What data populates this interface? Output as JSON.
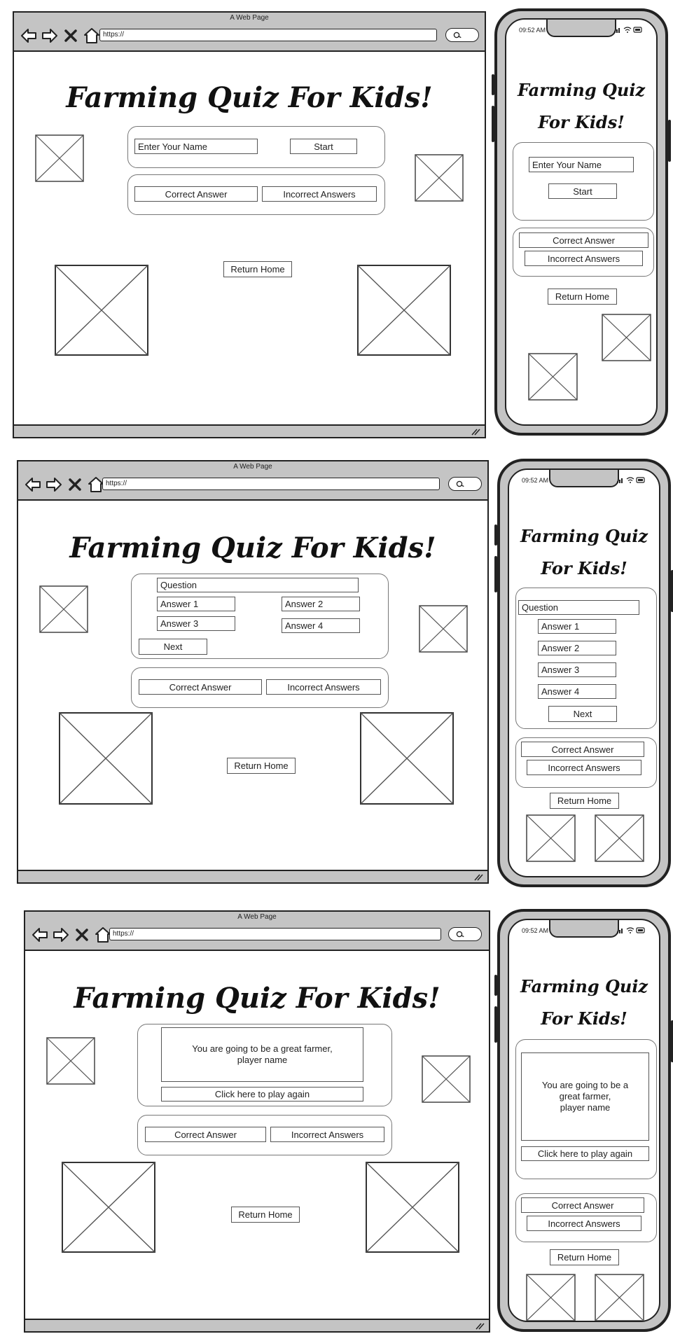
{
  "browser": {
    "title": "A Web Page",
    "url": "https://"
  },
  "phone": {
    "time": "09:52 AM"
  },
  "app": {
    "title": "Farming Quiz For Kids!",
    "mobile_title_line1": "Farming Quiz",
    "mobile_title_line2": "For Kids!"
  },
  "home": {
    "name_placeholder": "Enter Your Name",
    "start_label": "Start"
  },
  "quiz": {
    "question": "Question",
    "answers": [
      "Answer 1",
      "Answer 2",
      "Answer 3",
      "Answer 4"
    ],
    "next_label": "Next"
  },
  "results": {
    "message_desktop": "You are going to be a great farmer,\nplayer name",
    "message_mobile": "You are going to be a\ngreat farmer,\nplayer name",
    "play_again_label": "Click here to play again"
  },
  "score": {
    "correct_label": "Correct Answer",
    "incorrect_label": "Incorrect Answers"
  },
  "nav": {
    "return_home_label": "Return Home"
  },
  "icons": {
    "back": "arrow-left-icon",
    "forward": "arrow-right-icon",
    "close": "close-icon",
    "home": "home-icon",
    "search": "search-icon"
  }
}
